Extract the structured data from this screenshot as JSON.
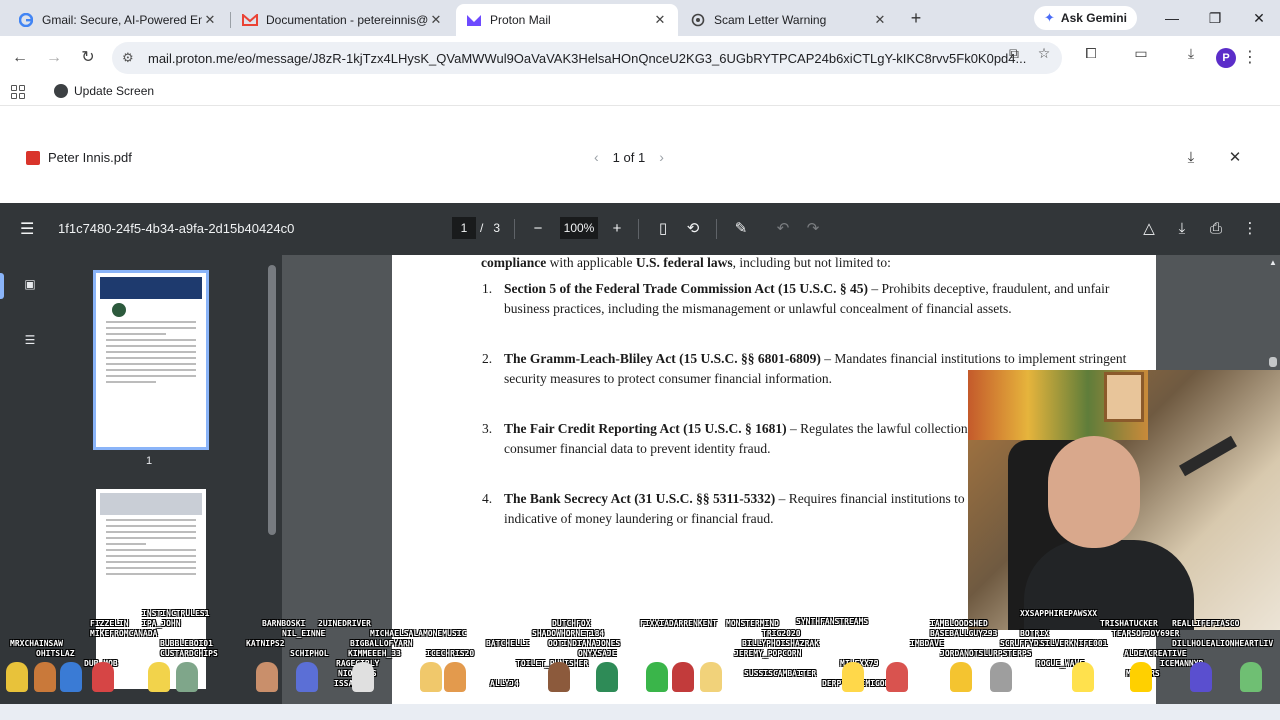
{
  "browser": {
    "tabs": [
      {
        "title": "Gmail: Secure, AI-Powered Ema",
        "favicon": "google-icon",
        "active": false
      },
      {
        "title": "Documentation - petereinnis@",
        "favicon": "gmail-icon",
        "active": false
      },
      {
        "title": "Proton Mail",
        "favicon": "proton-icon",
        "active": true
      },
      {
        "title": "Scam Letter Warning",
        "favicon": "chatgpt-icon",
        "active": false
      }
    ],
    "gemini_label": "Ask Gemini",
    "url": "mail.proton.me/eo/message/J8zR-1kjTzx4LHysK_QVaMWWul9OaVaVAK3HelsaHOnQnceU2KG3_6UGbRYTPCAP24b6xiCTLgY-kIKC8rvv5Fk0K0pd4...",
    "profile_initial": "P",
    "bookmark_label": "Update Screen"
  },
  "viewer": {
    "file_name": "Peter Innis.pdf",
    "page_indicator": "1 of 1"
  },
  "pdf_toolbar": {
    "doc_id": "1f1c7480-24f5-4b34-a9fa-2d15b40424c0",
    "current_page": "1",
    "page_separator": "/",
    "total_pages": "3",
    "zoom": "100%"
  },
  "thumbnails": [
    {
      "page": "1",
      "selected": true
    },
    {
      "page": "2",
      "selected": false
    }
  ],
  "document": {
    "intro_bold": "compliance",
    "intro_mid": " with applicable ",
    "intro_bold2": "U.S. federal laws",
    "intro_end": ", including but not limited to:",
    "laws": [
      {
        "num": "1.",
        "name": "Section 5 of the Federal Trade Commission Act (15 U.S.C. § 45)",
        "desc": " – Prohibits deceptive, fraudulent, and unfair business practices, including the mismanagement or unlawful concealment of financial assets."
      },
      {
        "num": "2.",
        "name": "The Gramm-Leach-Bliley Act (15 U.S.C. §§ 6801-6809)",
        "desc": " – Mandates financial institutions to implement stringent security measures to protect consumer financial information."
      },
      {
        "num": "3.",
        "name": "The Fair Credit Reporting Act (15 U.S.C. § 1681)",
        "desc": " – Regulates the lawful collection, handling, and dissemination of consumer financial data to prevent identity fraud."
      },
      {
        "num": "4.",
        "name": "The Bank Secrecy Act (31 U.S.C. §§ 5311-5332)",
        "desc": " – Requires financial institutions to report suspicious transactions indicative of money laundering or financial fraud."
      }
    ]
  },
  "stream_overlay": {
    "names": [
      "FIZZELIN",
      "INSTINCTRULES1",
      "IPA_JOHN",
      "MIKEFROMCANADA",
      "MRXCHAINSAW",
      "OHITSLAZ",
      "DUB_MOB",
      "BUBBLEBOI01",
      "CUSTARDCHIPS",
      "KATNIPS2",
      "BARNBOSKI",
      "2UINEDRIVER",
      "NIL_EINNE",
      "SCHIPHOL",
      "MICHAELSALAMONEMUSIC",
      "BIGBALLOFYARN",
      "KIMMEEEH_33",
      "RAGEGIRLY",
      "NIOBAITS",
      "ISSA_RON",
      "ICECHRIS20",
      "BATCHELLI",
      "ALLYJ4",
      "DUTCHFOX",
      "SHADOWHORNET184",
      "OOTINDIANAJONES",
      "ONYXSAJE",
      "TOILET_PUNISHER",
      "FIXXIADARRENKENT",
      "MONSTERMIND",
      "TRIG2020",
      "BILLYPHOISHAZRAK",
      "JEREMY_POPCORN",
      "SUSSISCAMBAITER",
      "SYNTHFANSTREAMS",
      "MILEXX79",
      "DERPTHEDEMIGOD",
      "IAMBLOODSHED",
      "BASEBALLGUY293",
      "IMBDAVE",
      "JORDANOTSLURPSTERPS",
      "XXSAPPHIREPAWSXX",
      "BOTRIX",
      "SCRUFFYD25",
      "SILVERKNIFE001",
      "ROGUE_WAVE",
      "TRISHATUCKER",
      "REALLIFEFIASCO",
      "TEARSOFJOY69ER",
      "DILLHOLEALIONHEARTLIV",
      "ALDEACREATIVE",
      "ICEMANNYR",
      "MRKIMRS"
    ]
  },
  "colors": {
    "tab_strip": "#dfe3eb",
    "pdf_toolbar": "#323639",
    "doc_background": "#525659",
    "accent": "#8ab4f8",
    "proton": "#6d4aff"
  }
}
